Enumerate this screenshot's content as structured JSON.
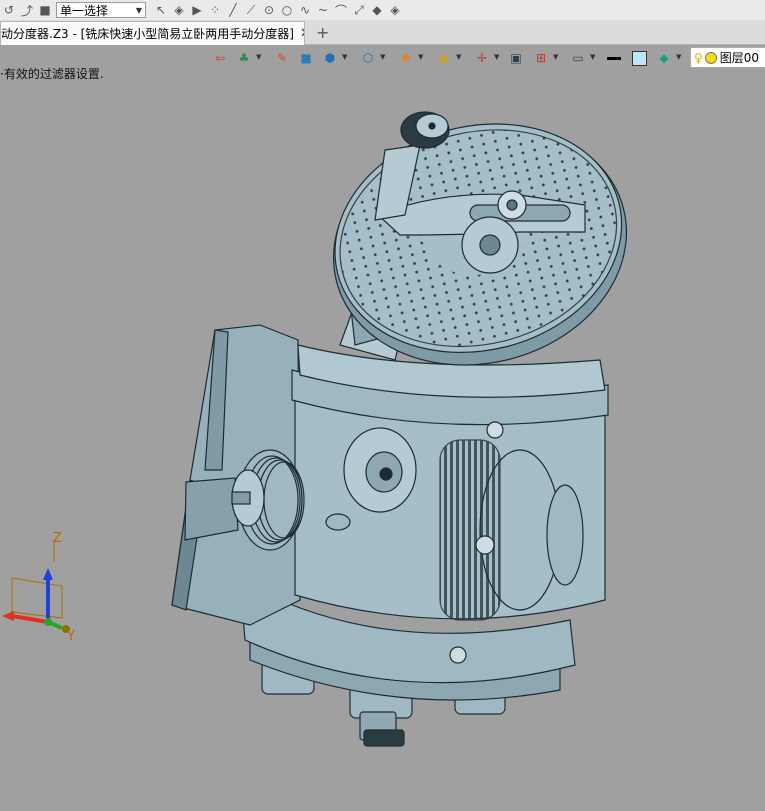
{
  "toolbar": {
    "select_mode": "单一选择"
  },
  "tab": {
    "title": "动分度器.Z3 - [铣床快速小型简易立卧两用手动分度器]",
    "close_glyph": "✕",
    "add_glyph": "+"
  },
  "status": {
    "filter_message": "有效的过滤器设置."
  },
  "layer": {
    "label": "图层00"
  },
  "triad": {
    "x_label": "",
    "y_label": "Y",
    "z_label": "Z"
  },
  "colors": {
    "background": "#a0a0a0",
    "model": "#9fb8c2",
    "model_dark": "#6d8892",
    "edge": "#1d2c33"
  }
}
